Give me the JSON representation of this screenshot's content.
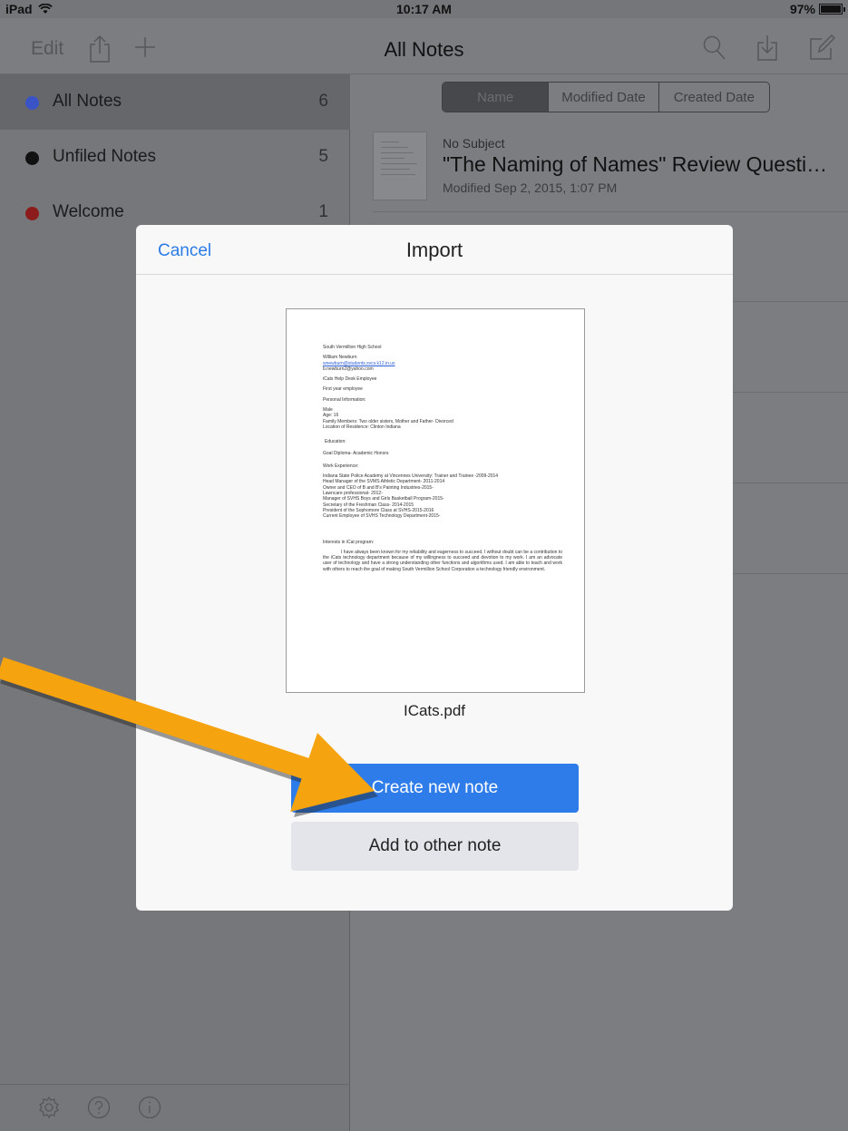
{
  "status_bar": {
    "device": "iPad",
    "time": "10:17 AM",
    "battery": "97%"
  },
  "nav": {
    "edit_label": "Edit",
    "title": "All Notes",
    "icons": [
      "share-icon",
      "plus-icon",
      "search-icon",
      "import-icon",
      "compose-icon"
    ]
  },
  "sidebar": {
    "folders": [
      {
        "name": "All Notes",
        "count": "6",
        "color": "#3a54c8"
      },
      {
        "name": "Unfiled Notes",
        "count": "5",
        "color": "#111111"
      },
      {
        "name": "Welcome",
        "count": "1",
        "color": "#8c1b1b"
      }
    ],
    "bottom_icons": [
      "gear-icon",
      "help-icon",
      "info-icon"
    ]
  },
  "notes": {
    "sort_options": [
      "Name",
      "Modified Date",
      "Created Date"
    ],
    "selected_sort": "Name",
    "items": [
      {
        "subject": "No Subject",
        "title": "\"The Naming of Names\" Review Questi…",
        "modified": "Modified Sep 2, 2015, 1:07 PM"
      }
    ]
  },
  "modal": {
    "cancel_label": "Cancel",
    "title": "Import",
    "file_name": "ICats.pdf",
    "primary_button": "Create new note",
    "secondary_button": "Add to other note",
    "document": {
      "school": "South Vermillion High School",
      "name": "William Newburn",
      "email_school": "wnewburn@students.svcs.k12.in.us",
      "email_personal": "b.newburn2@yahoo.com",
      "role": "iCats Help Desk Employee",
      "experience_level": "First year employee",
      "personal_heading": "Personal Information:",
      "personal_details": [
        "Male",
        "Age: 16",
        "Family Members: Two older sisters, Mother and Father- Divorced",
        "Location of Residence: Clinton Indiana"
      ],
      "education_heading": "Education:",
      "education": "Goal Diploma- Academic Honors",
      "work_heading": "Work Experience:",
      "work": [
        "Indiana State Police Academy at Vincennes University: Trainer and Trainee -2009-2014",
        "Head Manager of the SVMS Athletic Department- 2011-2014",
        "Owner and CEO of B and B's Painting Industries-2015-",
        "Lawncare professional- 2012-",
        "Manager of SVHS Boys and Girls Basketball Program-2015-",
        "Secretary of the Freshman Class- 2014-2015",
        "President of the Sophomore Class at SVHS-2015-2016",
        "Current Employee of SVHS Technology Department-2015-"
      ],
      "interests_heading": "Interests in iCat program:",
      "interests_paragraph": "I have always been known for my reliability and eagerness to succeed. I without doubt can be a contribution to the iCats technology department because of my willingness to succeed and devotion to my work. I am an advocate user of technology and have a strong understanding other functions and algorithms used. I am able to teach and work with others to reach the goal of making South Vermillion School Corporation a technology friendly environment."
    }
  },
  "annotation": {
    "arrow_color": "#f5a30e"
  }
}
